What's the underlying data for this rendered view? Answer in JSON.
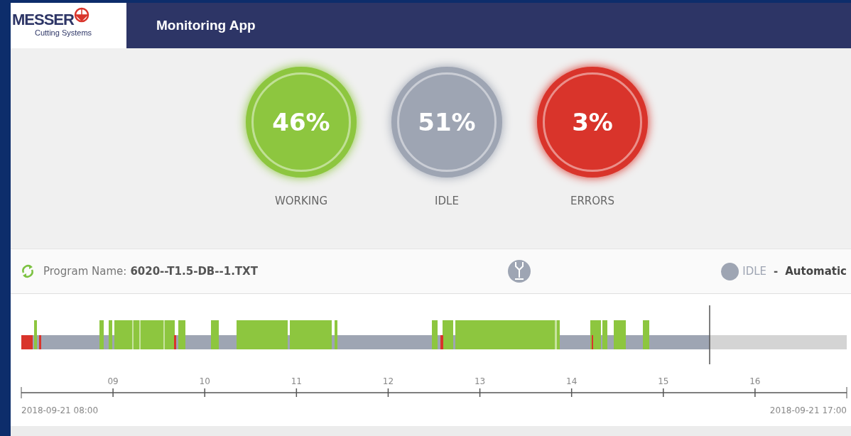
{
  "header": {
    "logo_name": "MESSER",
    "logo_subtitle": "Cutting Systems",
    "title": "Monitoring App"
  },
  "gauges": [
    {
      "value": "46%",
      "label": "WORKING",
      "color": "#8dc63f"
    },
    {
      "value": "51%",
      "label": "IDLE",
      "color": "#9ea5b3"
    },
    {
      "value": "3%",
      "label": "ERRORS",
      "color": "#d9342b"
    }
  ],
  "program": {
    "label": "Program Name:",
    "name": "6020--T1.5-DB--1.TXT"
  },
  "status": {
    "state": "IDLE",
    "color": "#9ea5b3",
    "separator": "-",
    "mode": "Automatic"
  },
  "timeline": {
    "ticks": [
      "09",
      "10",
      "11",
      "12",
      "13",
      "14",
      "15",
      "16"
    ],
    "start": "2018-09-21 08:00",
    "end": "2018-09-21 17:00"
  }
}
